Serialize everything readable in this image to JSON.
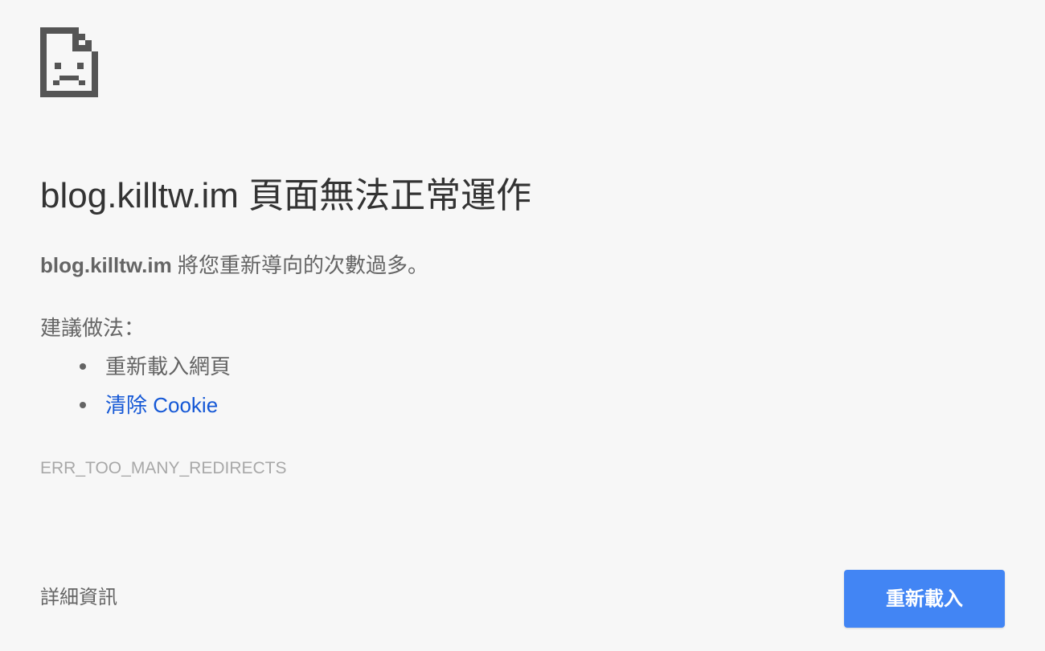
{
  "icon": "sad-page-icon",
  "title": "blog.killtw.im 頁面無法正常運作",
  "summary": {
    "host": "blog.killtw.im",
    "message": " 將您重新導向的次數過多。"
  },
  "suggestions": {
    "heading": "建議做法：",
    "items": [
      {
        "label": "重新載入網頁",
        "is_link": false
      },
      {
        "label": "清除 Cookie",
        "is_link": true
      }
    ]
  },
  "error_code": "ERR_TOO_MANY_REDIRECTS",
  "details_label": "詳細資訊",
  "reload_label": "重新載入",
  "colors": {
    "background": "#f7f7f7",
    "primary_button": "#4285f4",
    "link": "#1558d6",
    "error_code": "#a8a8a8"
  }
}
